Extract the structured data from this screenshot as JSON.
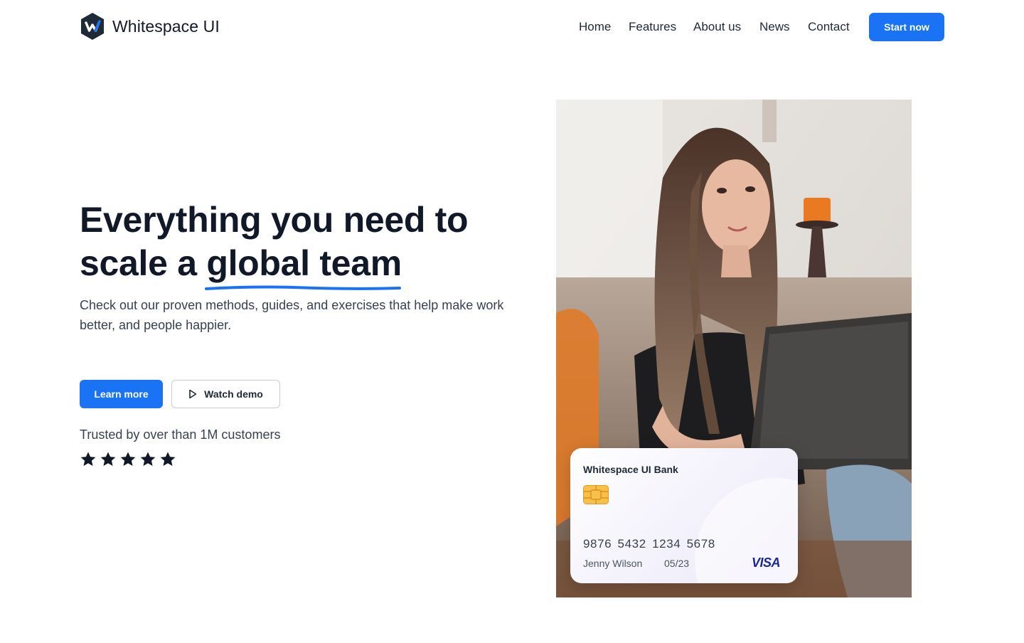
{
  "brand": {
    "name": "Whitespace UI",
    "logo_icon": "hexagon-w-logo-icon"
  },
  "nav": {
    "links": [
      {
        "label": "Home"
      },
      {
        "label": "Features"
      },
      {
        "label": "About us"
      },
      {
        "label": "News"
      },
      {
        "label": "Contact"
      }
    ],
    "cta_label": "Start now"
  },
  "hero": {
    "title_part1": "Everything you need to scale a ",
    "title_highlight": "global team",
    "subtitle": "Check out our proven methods, guides, and exercises that help make work better, and people happier.",
    "primary_button": "Learn more",
    "secondary_button": "Watch demo",
    "secondary_icon": "play-icon",
    "trusted_text": "Trusted by over than 1M customers",
    "rating": {
      "stars": 5,
      "max": 5,
      "icon": "star-icon"
    }
  },
  "photo": {
    "icon": "person-with-laptop-photo"
  },
  "card": {
    "bank_name": "Whitespace UI Bank",
    "number": "9876  5432  1234  5678",
    "holder": "Jenny Wilson",
    "expiry": "05/23",
    "network": "VISA",
    "chip_icon": "card-chip-icon"
  },
  "colors": {
    "accent": "#1a73f5",
    "text_dark": "#111827",
    "text_muted": "#374151",
    "visa_blue": "#1a2a8f"
  }
}
